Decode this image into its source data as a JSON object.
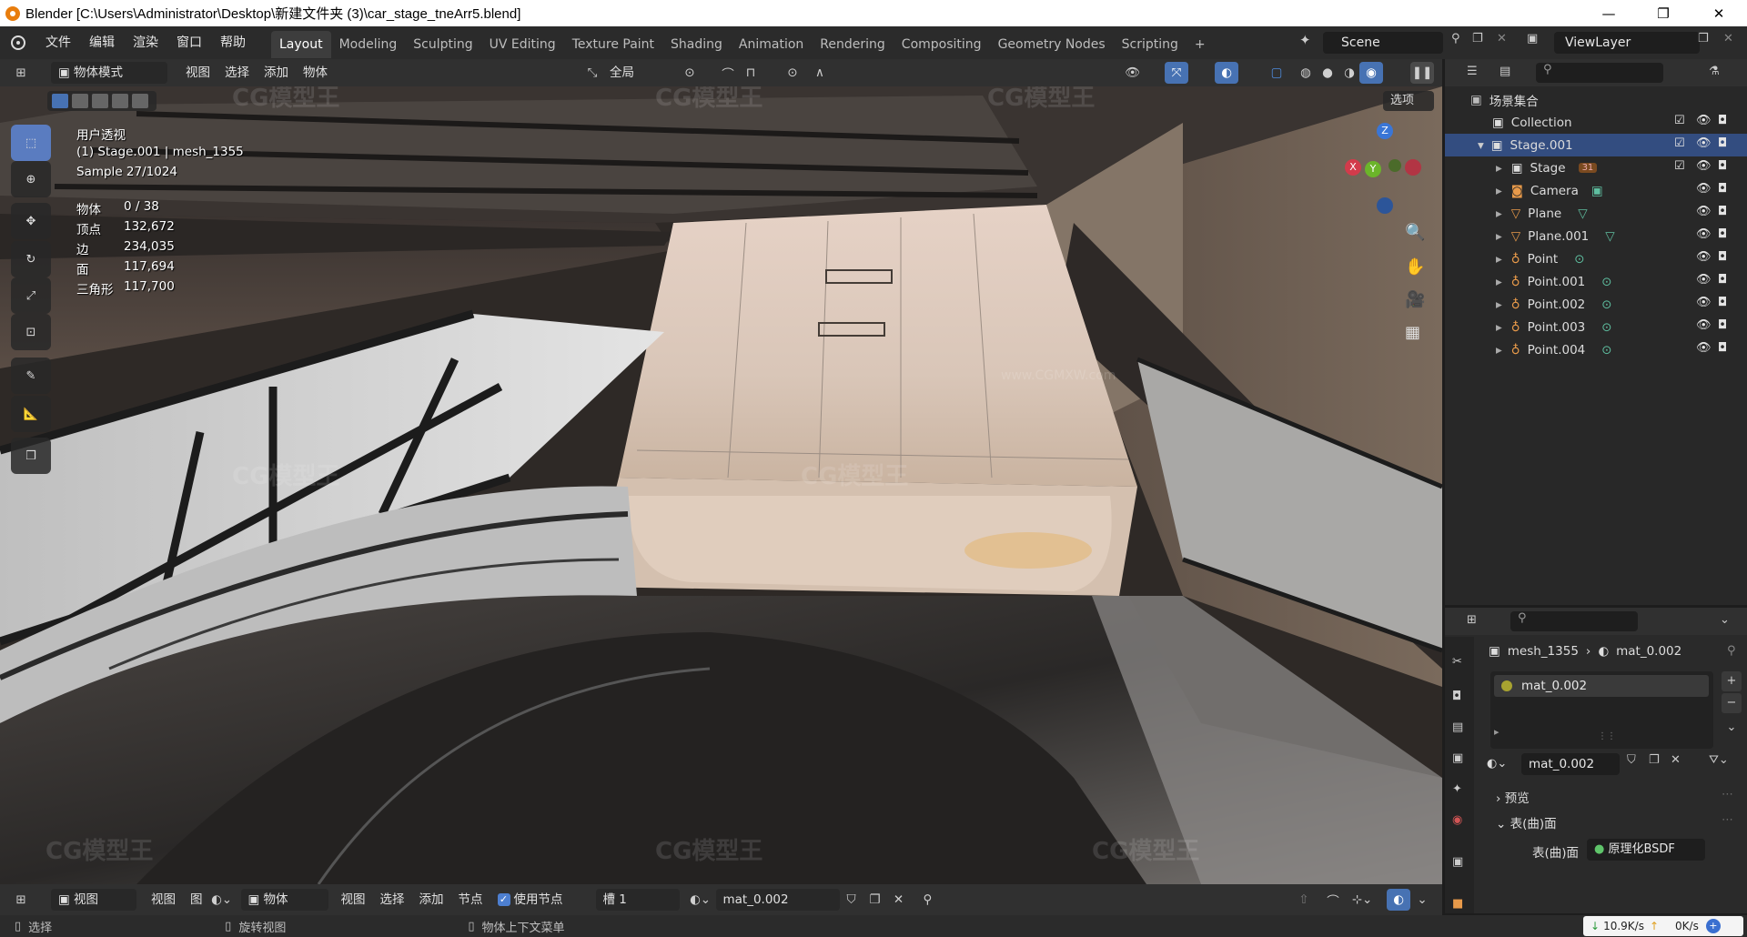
{
  "window": {
    "title": "Blender [C:\\Users\\Administrator\\Desktop\\新建文件夹 (3)\\car_stage_tneArr5.blend]",
    "minimize": "—",
    "maximize": "❐",
    "close": "✕"
  },
  "menu": [
    "文件",
    "编辑",
    "渲染",
    "窗口",
    "帮助"
  ],
  "workspaces": [
    "Layout",
    "Modeling",
    "Sculpting",
    "UV Editing",
    "Texture Paint",
    "Shading",
    "Animation",
    "Rendering",
    "Compositing",
    "Geometry Nodes",
    "Scripting"
  ],
  "active_workspace": "Layout",
  "add_workspace": "+",
  "scene": {
    "name": "Scene"
  },
  "view_layer": {
    "name": "ViewLayer"
  },
  "viewport_header": {
    "mode": "物体模式",
    "menus": [
      "视图",
      "选择",
      "添加",
      "物体"
    ],
    "transform_orientation": "全局",
    "options": "选项"
  },
  "viewport_overlay": {
    "view_name": "用户透视",
    "object_info": "(1) Stage.001 | mesh_1355",
    "sample": "Sample 27/1024",
    "stats": [
      {
        "label": "物体",
        "value": "0 / 38"
      },
      {
        "label": "顶点",
        "value": "132,672"
      },
      {
        "label": "边",
        "value": "234,035"
      },
      {
        "label": "面",
        "value": "117,694"
      },
      {
        "label": "三角形",
        "value": "117,700"
      }
    ],
    "watermark": "CG模型王",
    "watermark_url": "www.CGMXW.com"
  },
  "gizmo": {
    "x": "X",
    "y": "Y",
    "z": "Z"
  },
  "outliner": {
    "root": "场景集合",
    "items": [
      {
        "name": "Collection",
        "level": 1,
        "type": "collection"
      },
      {
        "name": "Stage.001",
        "level": 1,
        "type": "collection",
        "selected": true
      },
      {
        "name": "Stage",
        "level": 2,
        "type": "collection"
      },
      {
        "name": "Camera",
        "level": 2,
        "type": "camera"
      },
      {
        "name": "Plane",
        "level": 2,
        "type": "mesh"
      },
      {
        "name": "Plane.001",
        "level": 2,
        "type": "mesh"
      },
      {
        "name": "Point",
        "level": 2,
        "type": "light"
      },
      {
        "name": "Point.001",
        "level": 2,
        "type": "light"
      },
      {
        "name": "Point.002",
        "level": 2,
        "type": "light"
      },
      {
        "name": "Point.003",
        "level": 2,
        "type": "light"
      },
      {
        "name": "Point.004",
        "level": 2,
        "type": "light"
      }
    ],
    "stage_badge": "31"
  },
  "properties": {
    "breadcrumb_object": "mesh_1355",
    "breadcrumb_material": "mat_0.002",
    "slot_material": "mat_0.002",
    "material_name": "mat_0.002",
    "panel_preview": "预览",
    "panel_surface": "表(曲)面",
    "surface_label": "表(曲)面",
    "surface_value": "原理化BSDF"
  },
  "bottom_header": {
    "editor_menu": "视图",
    "menus1": [
      "视图",
      "图"
    ],
    "object_dropdown": "物体",
    "menus2": [
      "视图",
      "选择",
      "添加",
      "节点"
    ],
    "use_nodes": "使用节点",
    "slot": "槽 1",
    "material": "mat_0.002"
  },
  "statusbar": {
    "select": "选择",
    "rotate": "旋转视图",
    "context": "物体上下文菜单",
    "net_down": "10.9K/s",
    "net_up": "0K/s"
  },
  "colors": {
    "accent": "#4772b3",
    "selected_row": "#334d80",
    "header": "#303030"
  }
}
